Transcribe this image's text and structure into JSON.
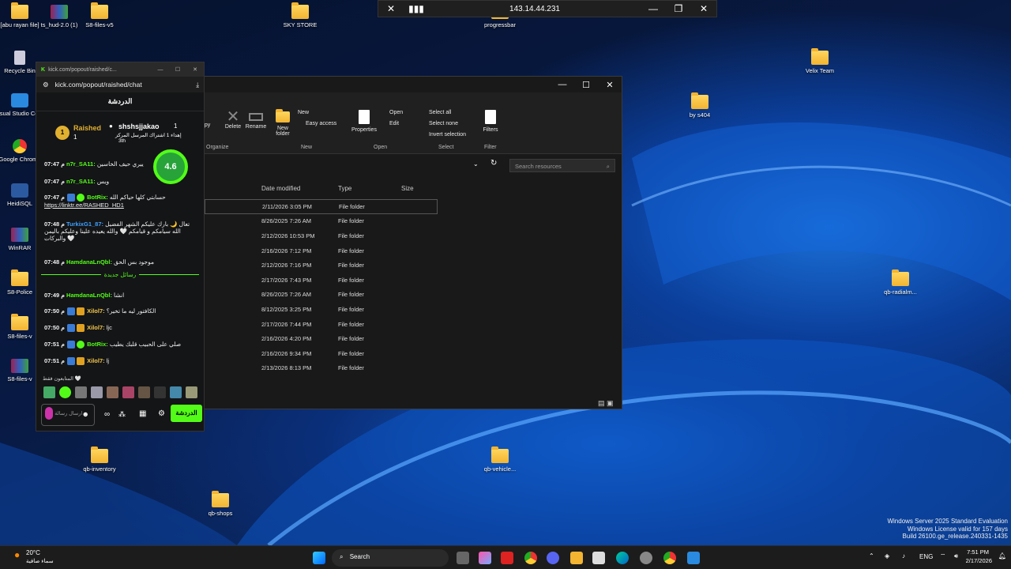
{
  "desktop_icons": [
    {
      "label": "[abu rayan file]",
      "icon": "folder"
    },
    {
      "label": "ts_hud-2.0 (1)",
      "icon": "winrar"
    },
    {
      "label": "S8-files-v5",
      "icon": "folder"
    },
    {
      "label": "SKY STORE",
      "icon": "folder"
    },
    {
      "label": "progressbar",
      "icon": "folder"
    },
    {
      "label": "Recycle Bin",
      "icon": "recycle-bin"
    },
    {
      "label": "Visual Studio Code",
      "icon": "vscode"
    },
    {
      "label": "Google Chrome",
      "icon": "chrome"
    },
    {
      "label": "HeidiSQL",
      "icon": "heidisql"
    },
    {
      "label": "WinRAR",
      "icon": "winrar"
    },
    {
      "label": "S8-Police",
      "icon": "folder"
    },
    {
      "label": "S8-files-v",
      "icon": "folder"
    },
    {
      "label": "S8-files-v",
      "icon": "winrar"
    },
    {
      "label": "Velix Team",
      "icon": "folder"
    },
    {
      "label": "by s404",
      "icon": "folder"
    },
    {
      "label": "qb-radialm...",
      "icon": "folder"
    },
    {
      "label": "qb-inventory",
      "icon": "folder"
    },
    {
      "label": "qb-vehicle...",
      "icon": "folder"
    },
    {
      "label": "qb-shops",
      "icon": "folder"
    }
  ],
  "rdp_bar": {
    "ip": "143.14.44.231"
  },
  "explorer": {
    "ribbon": {
      "buttons": {
        "copy": "opy",
        "delete": "Delete",
        "rename": "Rename",
        "new_folder": "New folder",
        "new_item": "New",
        "easy_access": "Easy access",
        "properties": "Properties",
        "open": "Open",
        "edit": "Edit",
        "select_all": "Select all",
        "select_none": "Select none",
        "invert_selection": "Invert selection",
        "filters": "Filters"
      },
      "groups": {
        "organize": "Organize",
        "new": "New",
        "open": "Open",
        "select": "Select",
        "filter": "Filter"
      }
    },
    "search_placeholder": "Search resources",
    "columns": [
      "Date modified",
      "Type",
      "Size"
    ],
    "rows": [
      {
        "date": "2/11/2026 3:05 PM",
        "type": "File folder"
      },
      {
        "date": "8/26/2025 7:26 AM",
        "type": "File folder"
      },
      {
        "date": "2/12/2026 10:53 PM",
        "type": "File folder"
      },
      {
        "date": "2/16/2026 7:12 PM",
        "type": "File folder"
      },
      {
        "date": "2/12/2026 7:16 PM",
        "type": "File folder"
      },
      {
        "date": "2/17/2026 7:43 PM",
        "type": "File folder"
      },
      {
        "date": "8/26/2025 7:26 AM",
        "type": "File folder"
      },
      {
        "date": "8/12/2025 3:25 PM",
        "type": "File folder"
      },
      {
        "date": "2/17/2026 7:44 PM",
        "type": "File folder"
      },
      {
        "date": "2/16/2026 4:20 PM",
        "type": "File folder"
      },
      {
        "date": "2/16/2026 9:34 PM",
        "type": "File folder"
      },
      {
        "date": "2/13/2026 8:13 PM",
        "type": "File folder"
      }
    ]
  },
  "chat": {
    "tab_title": "kick.com/popout/raished/c...",
    "url": "kick.com/popout/raished/chat",
    "header": "الدردشة",
    "leaderboard": {
      "rank_user": "Raished",
      "rank_num": "1",
      "rank_count": "1",
      "other_user": "shshsjjakao",
      "other_count": "1",
      "gift_text": "إهداء 1 اشتراك المرسل المركز",
      "place": "3th"
    },
    "rating": "4.6",
    "messages": [
      {
        "time": "07:47 م",
        "user": "n7r_SA11:",
        "text": "ييري حيف الخاسين",
        "color": "#53fc18"
      },
      {
        "time": "07:47 م",
        "user": "n7r_SA11:",
        "text": "ويس",
        "color": "#53fc18"
      },
      {
        "time": "07:47 م",
        "user": "BotRix:",
        "text": "حسابتي كلها حياكم الله",
        "color": "#53fc18",
        "link": "https://linktr.ee/RASHED_HD1"
      },
      {
        "time": "07:48 م",
        "user": "TurkixG1_87:",
        "text": "تعال 🌙 بارك عليكم الشهر الفضيل الله سيامكم و قيامكم 🤍 والله يعيده علينا وعليكم باليمن والبركات 🤍",
        "color": "#3fa1ff"
      },
      {
        "time": "07:48 م",
        "user": "HamdanaLnQbl:",
        "text": "موجود بس الحق",
        "color": "#53fc18"
      },
      {
        "time": "07:49 م",
        "user": "HamdanaLnQbl:",
        "text": "انشا",
        "color": "#53fc18"
      },
      {
        "time": "07:50 م",
        "user": "Xilol7:",
        "text": "الكافتور ليه ما تخير؟",
        "color": "#f5c84a"
      },
      {
        "time": "07:50 م",
        "user": "Xilol7:",
        "text": "ljc",
        "color": "#f5c84a"
      },
      {
        "time": "07:51 م",
        "user": "BotRix:",
        "text": "صلي على الحبيب قلبك يطيب",
        "color": "#53fc18"
      },
      {
        "time": "07:51 م",
        "user": "Xilol7:",
        "text": "lj",
        "color": "#f5c84a"
      }
    ],
    "new_messages_label": "رسائل جديدة",
    "viewers_label": "المتابعون فقط 🤍",
    "input_placeholder": "ارسال رسالة",
    "send_button": "الدردشة"
  },
  "watermark": {
    "line1": "Windows Server 2025 Standard Evaluation",
    "line2": "Windows License valid for 157 days",
    "line3": "Build 26100.ge_release.240331-1435"
  },
  "taskbar": {
    "weather_temp": "20°C",
    "weather_desc": "سماء صافية",
    "search_label": "Search",
    "lang": "ENG",
    "time": "7:51 PM",
    "date": "2/17/2026"
  },
  "colors": {
    "kick_green": "#53fc18",
    "folder_yellow": "#f2b431",
    "windows_blue": "#1a6fd6"
  }
}
